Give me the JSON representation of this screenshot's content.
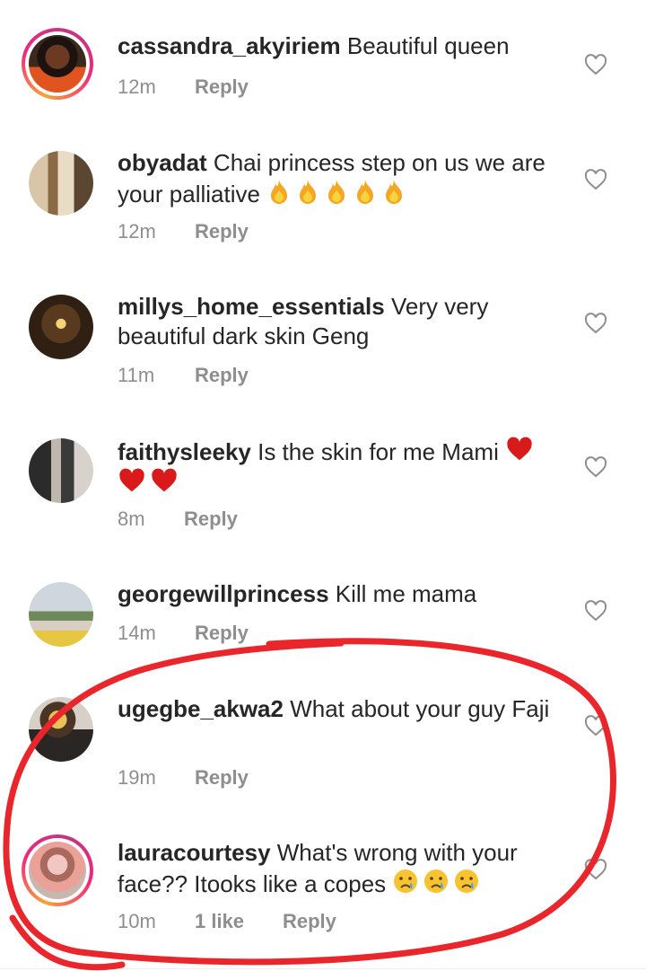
{
  "comments": [
    {
      "user": "cassandra_akyiriem",
      "text": "Beautiful queen",
      "time": "12m",
      "reply": "Reply"
    },
    {
      "user": "obyadat",
      "text": "Chai princess step on us we are your palliative",
      "time": "12m",
      "reply": "Reply",
      "emoji": "fire",
      "emoji_count": 5
    },
    {
      "user": "millys_home_essentials",
      "text": "Very very beautiful dark skin Geng",
      "time": "11m",
      "reply": "Reply"
    },
    {
      "user": "faithysleeky",
      "text": "Is the skin for me Mami",
      "time": "8m",
      "reply": "Reply",
      "emoji": "red-heart",
      "emoji_count": 3
    },
    {
      "user": "georgewillprincess",
      "text": "Kill me mama",
      "time": "14m",
      "reply": "Reply"
    },
    {
      "user": "ugegbe_akwa2",
      "text": "What about your guy Faji",
      "time": "19m",
      "reply": "Reply"
    },
    {
      "user": "lauracourtesy",
      "text": "What's wrong with your face?? Itooks like a copes",
      "time": "10m",
      "likes": "1 like",
      "reply": "Reply",
      "emoji": "crying-face",
      "emoji_count": 3
    }
  ],
  "colors": {
    "text": "#262626",
    "meta": "#8e8e8e",
    "annotation": "#e8262b"
  }
}
